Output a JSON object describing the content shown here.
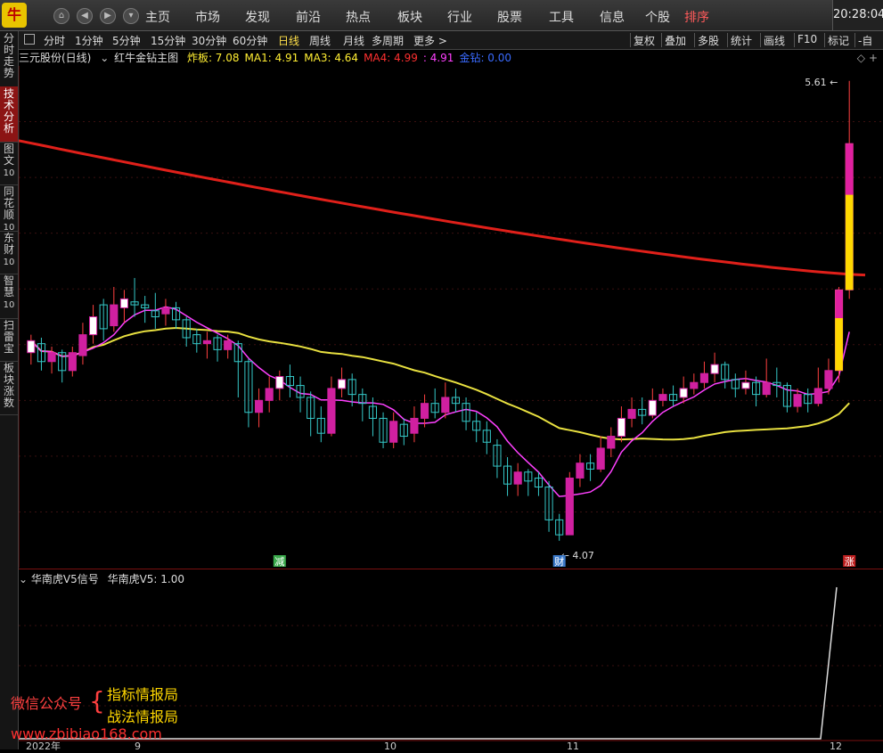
{
  "app": {
    "logo": "牛",
    "clock": "20:28:04"
  },
  "nav": {
    "back": "◀",
    "fwd": "▶",
    "down": "▾",
    "home": "⌂"
  },
  "menu": [
    {
      "label": "主页",
      "active": false
    },
    {
      "label": "市场",
      "active": false
    },
    {
      "label": "发现",
      "active": false
    },
    {
      "label": "前沿",
      "active": false
    },
    {
      "label": "热点",
      "active": false
    },
    {
      "label": "板块",
      "active": false
    },
    {
      "label": "行业",
      "active": false
    },
    {
      "label": "股票",
      "active": false
    },
    {
      "label": "工具",
      "active": false
    },
    {
      "label": "信息",
      "active": false
    },
    {
      "label": "个股",
      "active": false
    },
    {
      "label": "排序",
      "active": true
    }
  ],
  "sidebar": [
    {
      "label": "分时走势",
      "num": ""
    },
    {
      "label": "技术分析",
      "num": ""
    },
    {
      "label": "图文",
      "num": "10"
    },
    {
      "label": "同花顺",
      "num": "10"
    },
    {
      "label": "东财",
      "num": "10"
    },
    {
      "label": "智慧",
      "num": "10"
    },
    {
      "label": "扫雷宝",
      "num": ""
    },
    {
      "label": "板块涨数",
      "num": ""
    }
  ],
  "timeframes": [
    "分时",
    "1分钟",
    "5分钟",
    "15分钟",
    "30分钟",
    "60分钟",
    "日线",
    "周线",
    "月线",
    "多周期",
    "更多 >"
  ],
  "timeframe_active": "日线",
  "right_tools": [
    "复权",
    "叠加",
    "多股",
    "统计",
    "画线",
    "F10",
    "标记",
    "-自选"
  ],
  "info": {
    "stock": "三元股份(日线)",
    "indicator": "红牛金钻主图",
    "items": [
      {
        "label": "炸板: 7.08",
        "color": "#ffee33"
      },
      {
        "label": "MA1: 4.91",
        "color": "#ffee33"
      },
      {
        "label": "MA3: 4.64",
        "color": "#ffee33"
      },
      {
        "label": "MA4: 4.99",
        "color": "#ff3030"
      },
      {
        "label": ": 4.91",
        "color": "#ff40ff"
      },
      {
        "label": "金钻: 0.00",
        "color": "#3a6bff"
      }
    ]
  },
  "chart_data": {
    "type": "candlestick",
    "high_label": "5.61",
    "low_label": "4.07",
    "markers": [
      {
        "label": "减",
        "color": "#39a84a"
      },
      {
        "label": "财",
        "color": "#3a78c8"
      },
      {
        "label": "涨",
        "color": "#c02020"
      }
    ],
    "dates_axis": [
      "2022年",
      "9",
      "10",
      "11",
      "12"
    ],
    "candles": [
      [
        4.7,
        4.74,
        4.76,
        4.66
      ],
      [
        4.73,
        4.67,
        4.75,
        4.64
      ],
      [
        4.67,
        4.7,
        4.72,
        4.63
      ],
      [
        4.7,
        4.64,
        4.71,
        4.6
      ],
      [
        4.64,
        4.7,
        4.72,
        4.62
      ],
      [
        4.69,
        4.76,
        4.8,
        4.66
      ],
      [
        4.76,
        4.82,
        4.86,
        4.73
      ],
      [
        4.86,
        4.78,
        4.88,
        4.74
      ],
      [
        4.79,
        4.86,
        4.92,
        4.77
      ],
      [
        4.85,
        4.88,
        4.91,
        4.8
      ],
      [
        4.87,
        4.86,
        4.95,
        4.82
      ],
      [
        4.86,
        4.85,
        4.89,
        4.8
      ],
      [
        4.84,
        4.82,
        4.9,
        4.78
      ],
      [
        4.83,
        4.85,
        4.88,
        4.79
      ],
      [
        4.85,
        4.81,
        4.87,
        4.78
      ],
      [
        4.81,
        4.75,
        4.82,
        4.72
      ],
      [
        4.76,
        4.73,
        4.78,
        4.7
      ],
      [
        4.73,
        4.74,
        4.77,
        4.68
      ],
      [
        4.75,
        4.71,
        4.76,
        4.67
      ],
      [
        4.71,
        4.74,
        4.76,
        4.68
      ],
      [
        4.73,
        4.67,
        4.74,
        4.55
      ],
      [
        4.67,
        4.5,
        4.68,
        4.45
      ],
      [
        4.5,
        4.54,
        4.58,
        4.45
      ],
      [
        4.54,
        4.58,
        4.62,
        4.5
      ],
      [
        4.58,
        4.62,
        4.64,
        4.54
      ],
      [
        4.62,
        4.59,
        4.66,
        4.55
      ],
      [
        4.59,
        4.55,
        4.62,
        4.5
      ],
      [
        4.55,
        4.48,
        4.57,
        4.42
      ],
      [
        4.48,
        4.43,
        4.52,
        4.4
      ],
      [
        4.43,
        4.58,
        4.62,
        4.42
      ],
      [
        4.58,
        4.61,
        4.65,
        4.55
      ],
      [
        4.61,
        4.56,
        4.63,
        4.52
      ],
      [
        4.56,
        4.53,
        4.58,
        4.47
      ],
      [
        4.52,
        4.48,
        4.55,
        4.42
      ],
      [
        4.48,
        4.4,
        4.5,
        4.38
      ],
      [
        4.4,
        4.47,
        4.5,
        4.38
      ],
      [
        4.46,
        4.42,
        4.48,
        4.39
      ],
      [
        4.43,
        4.48,
        4.52,
        4.4
      ],
      [
        4.48,
        4.53,
        4.56,
        4.45
      ],
      [
        4.53,
        4.5,
        4.58,
        4.48
      ],
      [
        4.5,
        4.55,
        4.6,
        4.48
      ],
      [
        4.55,
        4.53,
        4.58,
        4.5
      ],
      [
        4.53,
        4.47,
        4.55,
        4.44
      ],
      [
        4.47,
        4.44,
        4.5,
        4.4
      ],
      [
        4.44,
        4.4,
        4.47,
        4.36
      ],
      [
        4.39,
        4.32,
        4.41,
        4.28
      ],
      [
        4.32,
        4.26,
        4.35,
        4.22
      ],
      [
        4.26,
        4.3,
        4.33,
        4.22
      ],
      [
        4.3,
        4.27,
        4.31,
        4.22
      ],
      [
        4.28,
        4.25,
        4.3,
        4.22
      ],
      [
        4.25,
        4.14,
        4.27,
        4.1
      ],
      [
        4.14,
        4.09,
        4.16,
        4.07
      ],
      [
        4.09,
        4.28,
        4.3,
        4.1
      ],
      [
        4.28,
        4.33,
        4.36,
        4.25
      ],
      [
        4.33,
        4.31,
        4.36,
        4.27
      ],
      [
        4.31,
        4.38,
        4.42,
        4.3
      ],
      [
        4.38,
        4.42,
        4.45,
        4.35
      ],
      [
        4.42,
        4.48,
        4.52,
        4.4
      ],
      [
        4.48,
        4.51,
        4.55,
        4.45
      ],
      [
        4.51,
        4.49,
        4.55,
        4.46
      ],
      [
        4.49,
        4.54,
        4.58,
        4.48
      ],
      [
        4.54,
        4.56,
        4.58,
        4.52
      ],
      [
        4.56,
        4.54,
        4.59,
        4.52
      ],
      [
        4.55,
        4.58,
        4.62,
        4.53
      ],
      [
        4.58,
        4.6,
        4.63,
        4.56
      ],
      [
        4.6,
        4.63,
        4.67,
        4.58
      ],
      [
        4.63,
        4.66,
        4.7,
        4.6
      ],
      [
        4.66,
        4.61,
        4.67,
        4.58
      ],
      [
        4.61,
        4.58,
        4.63,
        4.55
      ],
      [
        4.58,
        4.6,
        4.64,
        4.56
      ],
      [
        4.6,
        4.56,
        4.62,
        4.52
      ],
      [
        4.56,
        4.6,
        4.68,
        4.55
      ],
      [
        4.6,
        4.59,
        4.65,
        4.55
      ],
      [
        4.59,
        4.52,
        4.6,
        4.5
      ],
      [
        4.52,
        4.56,
        4.58,
        4.5
      ],
      [
        4.56,
        4.53,
        4.58,
        4.5
      ],
      [
        4.53,
        4.58,
        4.65,
        4.52
      ],
      [
        4.58,
        4.64,
        4.68,
        4.56
      ],
      [
        4.64,
        4.91,
        4.92,
        4.6
      ],
      [
        4.91,
        5.4,
        5.61,
        4.88
      ]
    ],
    "ma_red_range": [
      5.41,
      4.96
    ],
    "ma_yellow_range": [
      4.82,
      4.58
    ]
  },
  "sub": {
    "name": "华南虎V5信号",
    "value_label": "华南虎V5: 1.00"
  },
  "watermark": {
    "left": "微信公众号",
    "brace": "{",
    "line1": "指标情报局",
    "line2": "战法情报局",
    "url": "www.zbibiao168.com"
  }
}
